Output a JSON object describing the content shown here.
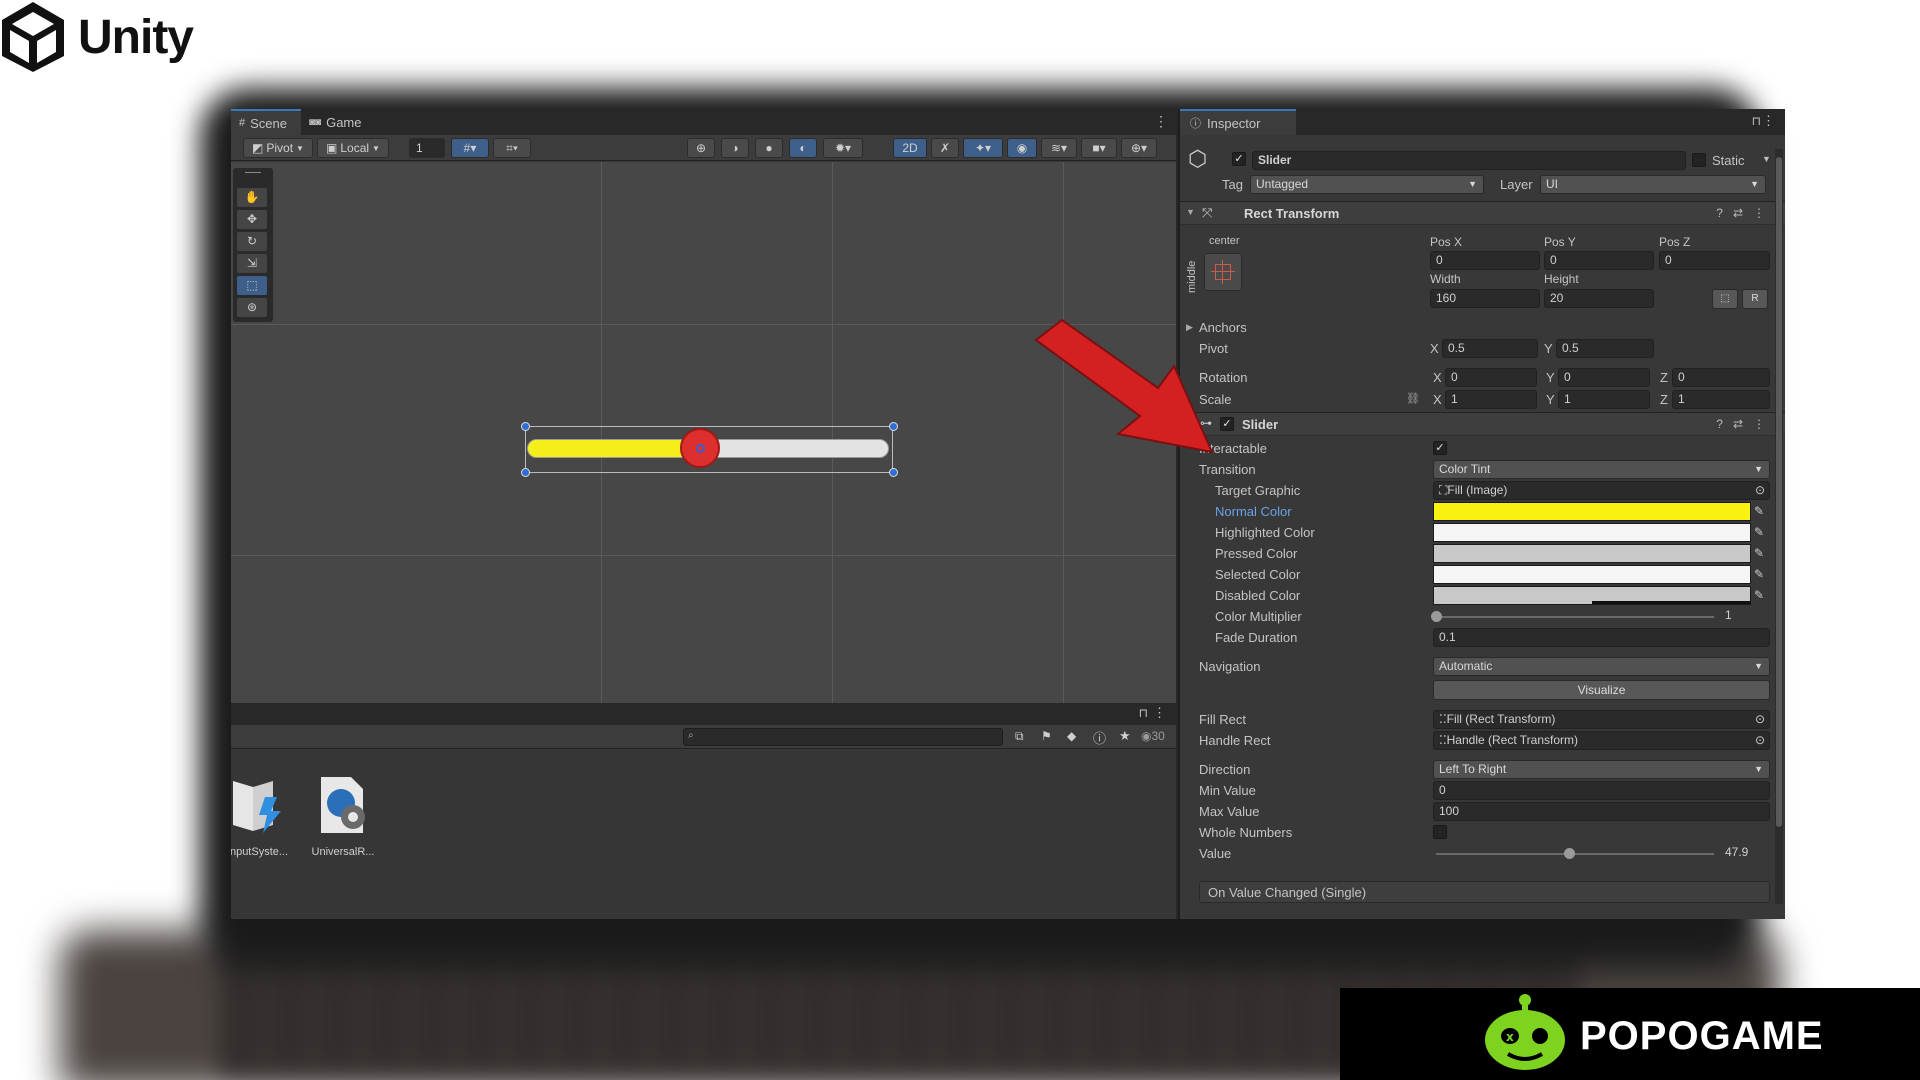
{
  "brand": {
    "name": "Unity"
  },
  "watermark": {
    "name": "POPOGAME"
  },
  "scene": {
    "tabs": [
      "Scene",
      "Game"
    ],
    "toolbar": {
      "pivot": "Pivot",
      "local": "Local",
      "snap_value": "1",
      "mode_2d": "2D"
    },
    "slider_value_fraction": 0.479
  },
  "project": {
    "count": "30",
    "assets": [
      {
        "label": "nputSyste..."
      },
      {
        "label": "UniversalR..."
      }
    ]
  },
  "inspector": {
    "tab": "Inspector",
    "object": {
      "name": "Slider",
      "static_label": "Static",
      "tag_label": "Tag",
      "tag": "Untagged",
      "layer_label": "Layer",
      "layer": "UI"
    },
    "rect_transform": {
      "title": "Rect Transform",
      "anchor_h": "center",
      "anchor_v": "middle",
      "pos_x_label": "Pos X",
      "pos_x": "0",
      "pos_y_label": "Pos Y",
      "pos_y": "0",
      "pos_z_label": "Pos Z",
      "pos_z": "0",
      "width_label": "Width",
      "width": "160",
      "height_label": "Height",
      "height": "20",
      "r_button": "R",
      "anchors_label": "Anchors",
      "pivot_label": "Pivot",
      "pivot_x": "0.5",
      "pivot_y": "0.5",
      "rotation_label": "Rotation",
      "rot_x": "0",
      "rot_y": "0",
      "rot_z": "0",
      "scale_label": "Scale",
      "scale_x": "1",
      "scale_y": "1",
      "scale_z": "1",
      "axis_x": "X",
      "axis_y": "Y",
      "axis_z": "Z"
    },
    "slider": {
      "title": "Slider",
      "interactable_label": "Interactable",
      "transition_label": "Transition",
      "transition": "Color Tint",
      "target_graphic_label": "Target Graphic",
      "target_graphic": "Fill (Image)",
      "normal_color_label": "Normal Color",
      "highlighted_color_label": "Highlighted Color",
      "pressed_color_label": "Pressed Color",
      "selected_color_label": "Selected Color",
      "disabled_color_label": "Disabled Color",
      "color_multiplier_label": "Color Multiplier",
      "color_multiplier": "1",
      "fade_duration_label": "Fade Duration",
      "fade_duration": "0.1",
      "navigation_label": "Navigation",
      "navigation": "Automatic",
      "visualize_label": "Visualize",
      "fill_rect_label": "Fill Rect",
      "fill_rect": "Fill (Rect Transform)",
      "handle_rect_label": "Handle Rect",
      "handle_rect": "Handle (Rect Transform)",
      "direction_label": "Direction",
      "direction": "Left To Right",
      "min_value_label": "Min Value",
      "min_value": "0",
      "max_value_label": "Max Value",
      "max_value": "100",
      "whole_numbers_label": "Whole Numbers",
      "value_label": "Value",
      "value": "47.9",
      "on_value_changed_label": "On Value Changed (Single)"
    },
    "colors": {
      "normal": "#f9f210",
      "highlighted": "#f5f5f5",
      "pressed": "#c8c8c8",
      "selected": "#f5f5f5",
      "disabled": "#c8c8c8"
    }
  },
  "colors": {
    "accent": "#3a79bb",
    "arrow": "#d42020",
    "slider_fill": "#f4ee1a",
    "knob": "#de2f2f"
  }
}
